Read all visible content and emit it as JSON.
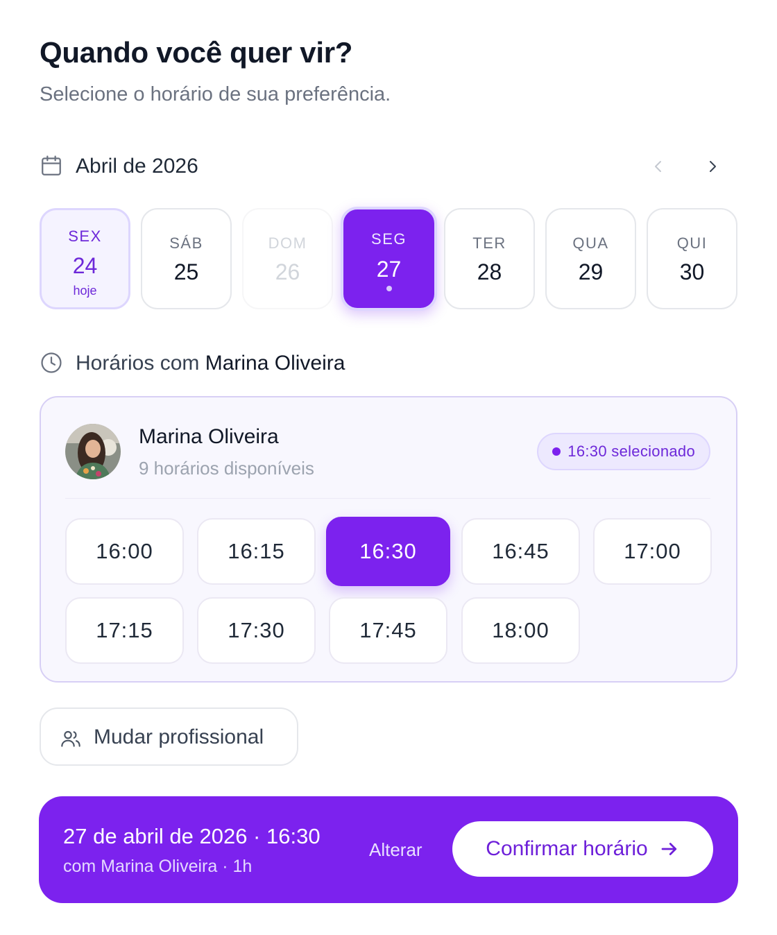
{
  "header": {
    "title": "Quando você quer vir?",
    "subtitle": "Selecione o horário de sua preferência."
  },
  "calendar": {
    "icon": "calendar-icon",
    "month_label": "Abril de 2026",
    "prev_icon": "chevron-left-icon",
    "next_icon": "chevron-right-icon",
    "days": [
      {
        "dow": "SEX",
        "num": "24",
        "note": "hoje",
        "state": "today"
      },
      {
        "dow": "SÁB",
        "num": "25",
        "state": "normal"
      },
      {
        "dow": "DOM",
        "num": "26",
        "state": "disabled"
      },
      {
        "dow": "SEG",
        "num": "27",
        "state": "selected"
      },
      {
        "dow": "TER",
        "num": "28",
        "state": "normal"
      },
      {
        "dow": "QUA",
        "num": "29",
        "state": "normal"
      },
      {
        "dow": "QUI",
        "num": "30",
        "state": "normal"
      }
    ]
  },
  "professional_section": {
    "icon": "clock-icon",
    "heading_prefix": "Horários com",
    "heading_name": "Marina Oliveira"
  },
  "professional": {
    "name": "Marina Oliveira",
    "availability": "9 horários disponíveis",
    "selected_badge": "16:30 selecionado",
    "slots": [
      {
        "time": "16:00",
        "selected": false
      },
      {
        "time": "16:15",
        "selected": false
      },
      {
        "time": "16:30",
        "selected": true
      },
      {
        "time": "16:45",
        "selected": false
      },
      {
        "time": "17:00",
        "selected": false
      },
      {
        "time": "17:15",
        "selected": false
      },
      {
        "time": "17:30",
        "selected": false
      },
      {
        "time": "17:45",
        "selected": false
      },
      {
        "time": "18:00",
        "selected": false
      }
    ]
  },
  "change_professional": {
    "icon": "users-icon",
    "label": "Mudar profissional"
  },
  "summary": {
    "when": "27 de abril de 2026 · 16:30",
    "with": "com Marina Oliveira · 1h",
    "change_label": "Alterar",
    "confirm_label": "Confirmar horário",
    "confirm_icon": "arrow-right-icon"
  },
  "colors": {
    "accent": "#7c22ee",
    "accent_soft": "#ede9fe",
    "text": "#111827",
    "muted": "#6b7280"
  }
}
